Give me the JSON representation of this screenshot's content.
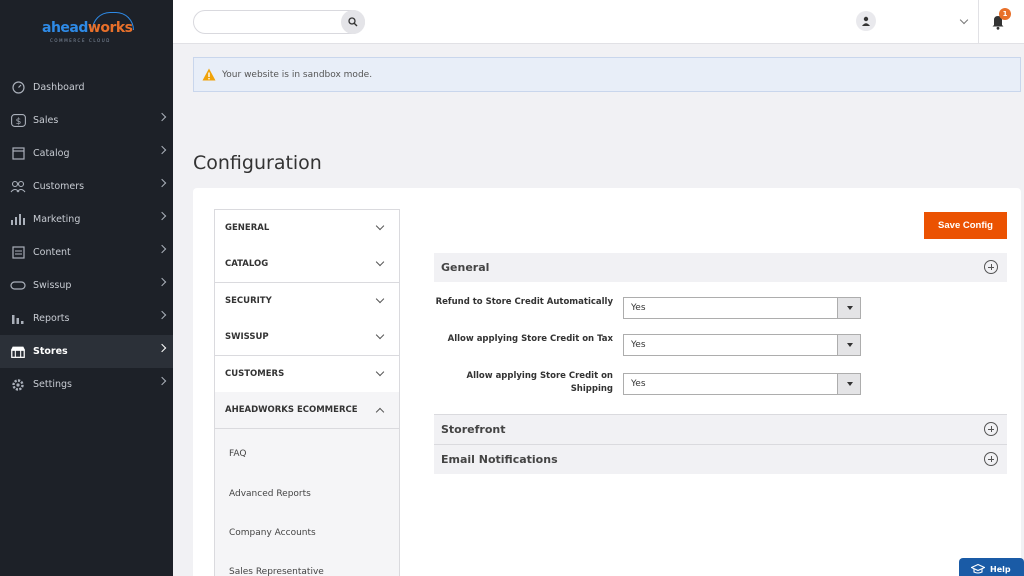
{
  "brand": {
    "name_part1": "ahead",
    "name_part2": "works",
    "tagline": "COMMERCE CLOUD"
  },
  "sidebar": {
    "items": [
      {
        "label": "Dashboard",
        "icon": "dashboard-icon",
        "has_submenu": false
      },
      {
        "label": "Sales",
        "icon": "dollar-icon",
        "has_submenu": true
      },
      {
        "label": "Catalog",
        "icon": "catalog-icon",
        "has_submenu": true
      },
      {
        "label": "Customers",
        "icon": "customers-icon",
        "has_submenu": true
      },
      {
        "label": "Marketing",
        "icon": "marketing-icon",
        "has_submenu": true
      },
      {
        "label": "Content",
        "icon": "content-icon",
        "has_submenu": true
      },
      {
        "label": "Swissup",
        "icon": "swissup-icon",
        "has_submenu": true
      },
      {
        "label": "Reports",
        "icon": "reports-icon",
        "has_submenu": true
      },
      {
        "label": "Stores",
        "icon": "store-icon",
        "has_submenu": true,
        "active": true
      },
      {
        "label": "Settings",
        "icon": "gear-icon",
        "has_submenu": true
      }
    ]
  },
  "header": {
    "search": {
      "value": "",
      "placeholder": ""
    },
    "notifications_count": "1"
  },
  "notice": {
    "text": "Your website is in sandbox mode."
  },
  "page": {
    "title": "Configuration"
  },
  "config_tabs": [
    {
      "label": "GENERAL",
      "expanded": false
    },
    {
      "label": "CATALOG",
      "expanded": false
    },
    {
      "label": "SECURITY",
      "expanded": false
    },
    {
      "label": "SWISSUP",
      "expanded": false
    },
    {
      "label": "CUSTOMERS",
      "expanded": false
    },
    {
      "label": "AHEADWORKS ECOMMERCE",
      "expanded": true
    }
  ],
  "subtabs": [
    "FAQ",
    "Advanced Reports",
    "Company Accounts",
    "Sales Representative"
  ],
  "actions": {
    "save_label": "Save Config"
  },
  "sections": [
    {
      "title": "General",
      "fields": [
        {
          "label": "Refund to Store Credit Automatically",
          "value": "Yes"
        },
        {
          "label": "Allow applying Store Credit on Tax",
          "value": "Yes"
        },
        {
          "label": "Allow applying Store Credit on Shipping",
          "value": "Yes"
        }
      ]
    },
    {
      "title": "Storefront"
    },
    {
      "title": "Email Notifications"
    }
  ],
  "help": {
    "label": "Help"
  },
  "colors": {
    "sidebar_bg": "#1d2128",
    "accent": "#eb5202",
    "link_blue": "#1a5ba6"
  }
}
